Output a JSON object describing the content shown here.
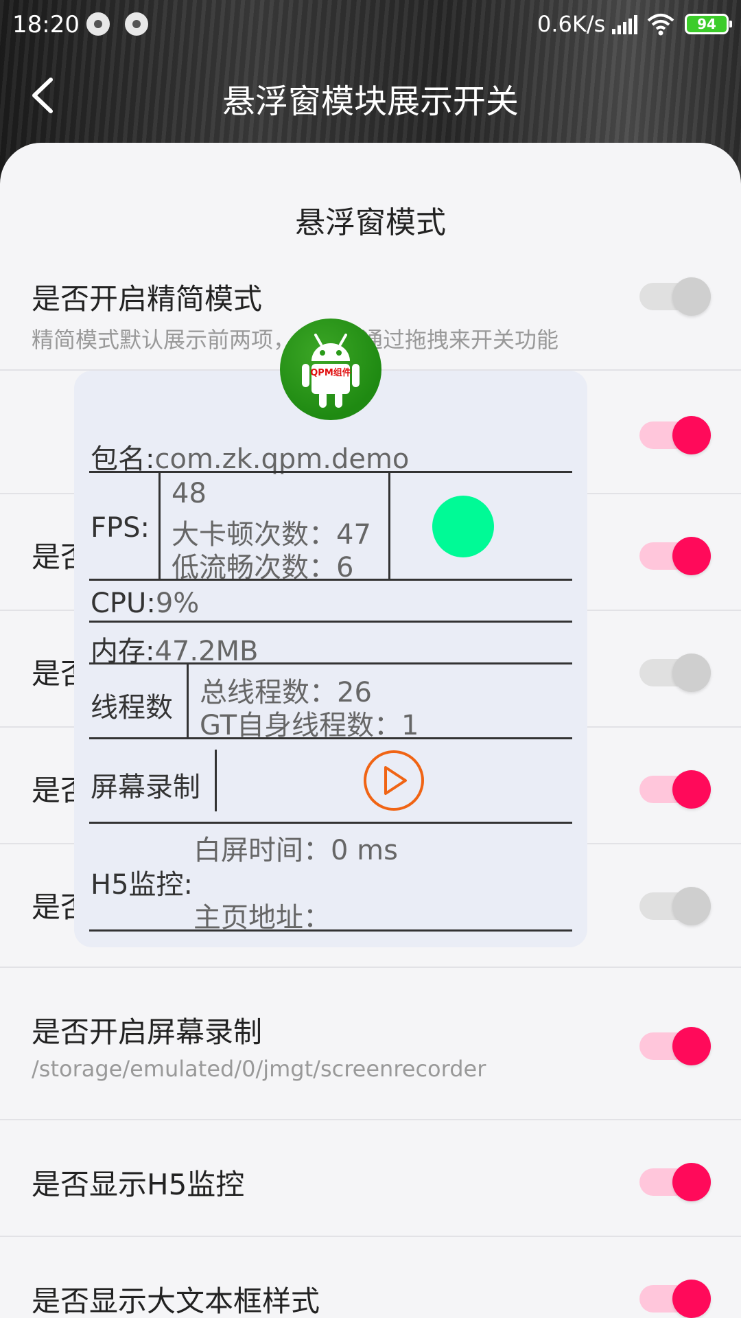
{
  "status_bar": {
    "time": "18:20",
    "net_speed": "0.6K/s",
    "battery": "94",
    "battery_color": "#3ccc2a"
  },
  "header": {
    "title": "悬浮窗模块展示开关",
    "back_icon": "chevron-left-icon"
  },
  "section": {
    "title": "悬浮窗模式"
  },
  "settings": [
    {
      "title": "是否开启精简模式",
      "subtitle": "精简模式默认展示前两项，且只能通过拖拽来开关功能",
      "on": false
    },
    {
      "title": "",
      "subtitle": "",
      "on": true
    },
    {
      "title": "是否",
      "subtitle": "",
      "on": true
    },
    {
      "title": "是否",
      "subtitle": "",
      "on": false
    },
    {
      "title": "是否",
      "subtitle": "",
      "on": true
    },
    {
      "title": "是否",
      "subtitle": "",
      "on": false
    },
    {
      "title": "是否开启屏幕录制",
      "subtitle": "/storage/emulated/0/jmgt/screenrecorder",
      "on": true
    },
    {
      "title": "是否显示H5监控",
      "subtitle": "",
      "on": true
    },
    {
      "title": "是否显示大文本框样式",
      "subtitle": "",
      "on": true
    }
  ],
  "overlay": {
    "logo_text": "QPM组件",
    "package_label": "包名:",
    "package_value": "com.zk.qpm.demo",
    "fps_label": "FPS:",
    "fps_value": "48",
    "big_jank_label": "大卡顿次数：",
    "big_jank_value": "47",
    "low_smooth_label": "低流畅次数：",
    "low_smooth_value": "6",
    "cpu_label": "CPU:",
    "cpu_value": "9%",
    "memory_label": "内存:",
    "memory_value": "47.2MB",
    "thread_label": "线程数",
    "total_threads_label": "总线程数：",
    "total_threads_value": "26",
    "gt_threads_label": "GT自身线程数：",
    "gt_threads_value": "1",
    "record_label": "屏幕录制",
    "h5_label": "H5监控:",
    "white_screen_label": "白屏时间：",
    "white_screen_value": "0 ms",
    "homepage_label": "主页地址：",
    "fps_indicator_color": "#00fa96",
    "record_color": "#f06414"
  },
  "colors": {
    "toggle_on": "#ff0a5a",
    "toggle_on_track": "#ffc6db",
    "toggle_off": "#cfcfcf"
  }
}
